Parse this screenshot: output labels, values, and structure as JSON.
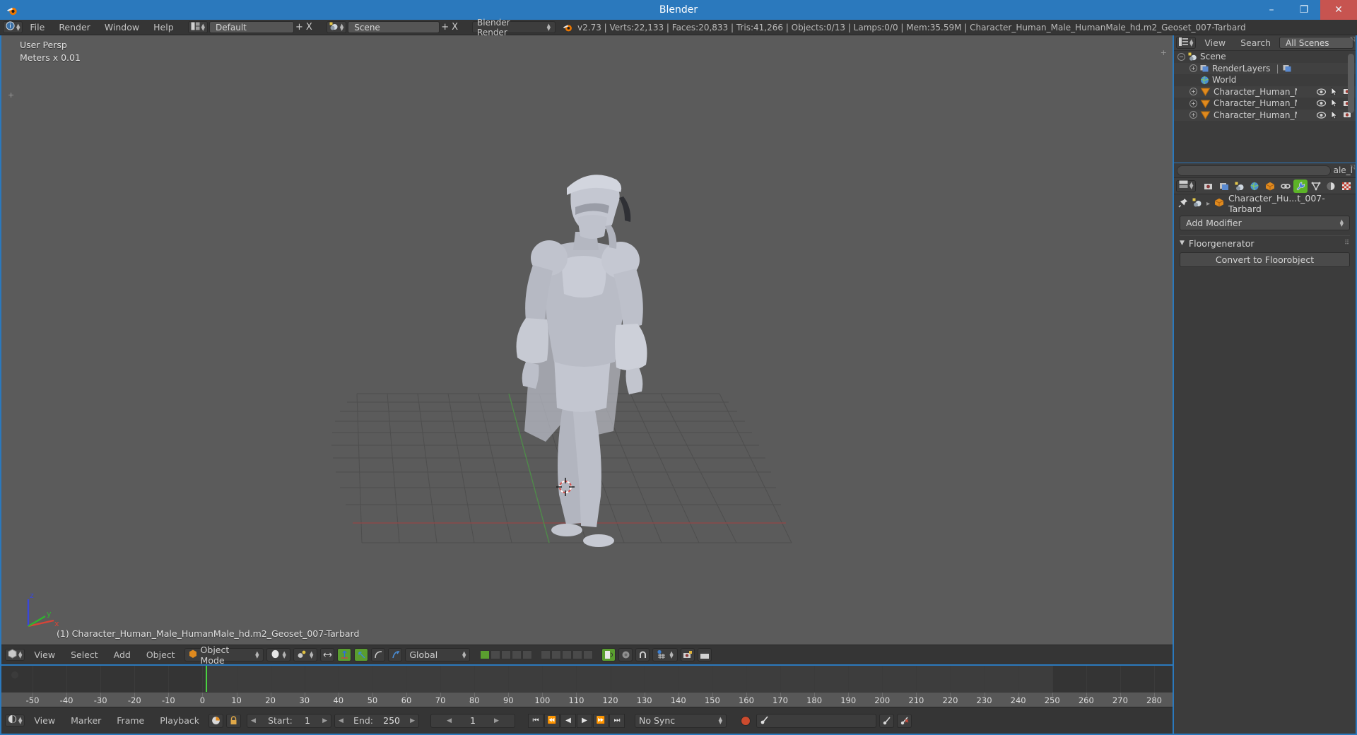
{
  "window": {
    "title": "Blender",
    "app_icon": "blender-logo-icon",
    "minimize": "–",
    "maximize": "❐",
    "close": "✕"
  },
  "topbar": {
    "editor_type_icon": "info-editor-icon",
    "menus": [
      "File",
      "Render",
      "Window",
      "Help"
    ],
    "screen_layout_icon": "screen-layout-icon",
    "screen_layout": "Default",
    "screen_add": "+",
    "screen_delete": "X",
    "scene_icon": "scene-icon",
    "scene": "Scene",
    "scene_add": "+",
    "scene_delete": "X",
    "render_engine": "Blender Render",
    "blender_icon": "blender-logo-icon",
    "status": "v2.73 | Verts:22,133 | Faces:20,833 | Tris:41,266 | Objects:0/13 | Lamps:0/0 | Mem:35.59M | Character_Human_Male_HumanMale_hd.m2_Geoset_007-Tarbard"
  },
  "viewport": {
    "perspective": "User Persp",
    "units": "Meters x 0.01",
    "active_object": "(1) Character_Human_Male_HumanMale_hd.m2_Geoset_007-Tarbard",
    "gizmo_axes": [
      "z",
      "y",
      "x"
    ],
    "background_color": "#5b5b5b",
    "header": {
      "editor_type_icon": "3d-view-icon",
      "menus": [
        "View",
        "Select",
        "Add",
        "Object"
      ],
      "mode_icon": "object-mode-icon",
      "mode": "Object Mode",
      "viewport_shading_icon": "shading-solid-icon",
      "pivot_icon": "pivot-median-icon",
      "manipulator_icon": "manipulator-icon",
      "transform_translate_icon": "translate-manipulator-icon",
      "transform_rotate_icon": "rotate-manipulator-icon",
      "transform_scale_icon": "scale-manipulator-icon",
      "orientation": "Global",
      "layers_label": "scene-layers",
      "active_layer_index": 0,
      "snap_icon": "snap-magnet-icon",
      "proportional_icon": "proportional-edit-icon",
      "render_icon": "render-preview-icon",
      "camera_icon": "add-camera-icon",
      "clip_icon": "movie-clip-icon",
      "lock_icon": "lock-icon"
    }
  },
  "timeline": {
    "ruler_ticks": [
      -50,
      -40,
      -30,
      -20,
      -10,
      0,
      10,
      20,
      30,
      40,
      50,
      60,
      70,
      80,
      90,
      100,
      110,
      120,
      130,
      140,
      150,
      160,
      170,
      180,
      190,
      200,
      210,
      220,
      230,
      240,
      250,
      260,
      270,
      280
    ],
    "range_start": 1,
    "range_end": 250,
    "playhead_frame": 1,
    "footer": {
      "editor_type_icon": "timeline-editor-icon",
      "menus": [
        "View",
        "Marker",
        "Frame",
        "Playback"
      ],
      "auto_key_icon": "record-auto-key-icon",
      "lock_icon": "lock-icon",
      "start_label": "Start:",
      "start_value": "1",
      "end_label": "End:",
      "end_value": "250",
      "current_frame": "1",
      "jump_start": "⏮",
      "prev_keyframe": "⏪",
      "play_reverse": "◀",
      "play": "▶",
      "next_keyframe": "⏩",
      "jump_end": "⏭",
      "sync_mode": "No Sync",
      "record_icon": "record-icon",
      "keying_set_icon": "keying-set-icon",
      "keying_set_value": "",
      "add_keyframe_icon": "add-keyframe-icon",
      "remove_keyframe_icon": "remove-keyframe-icon"
    }
  },
  "outliner": {
    "editor_type_icon": "outliner-editor-icon",
    "menus": [
      "View",
      "Search"
    ],
    "display_mode": "All Scenes",
    "rows": [
      {
        "label": "Scene",
        "icon": "scene-icon",
        "indent": 0,
        "expander": "collapse",
        "has_restrict": false
      },
      {
        "label": "RenderLayers",
        "icon": "renderlayers-icon",
        "indent": 1,
        "expander": "expand",
        "has_restrict": false
      },
      {
        "label": "World",
        "icon": "world-icon",
        "indent": 1,
        "expander": "none",
        "has_restrict": false
      },
      {
        "label": "Character_Human_Male",
        "icon": "mesh-object-icon",
        "indent": 1,
        "expander": "expand",
        "has_restrict": true
      },
      {
        "label": "Character_Human_Male",
        "icon": "mesh-object-icon",
        "indent": 1,
        "expander": "expand",
        "has_restrict": true
      },
      {
        "label": "Character_Human_Male",
        "icon": "mesh-object-icon",
        "indent": 1,
        "expander": "expand",
        "has_restrict": true
      }
    ],
    "restrict_icons": [
      "eye-icon",
      "cursor-select-icon",
      "camera-render-icon"
    ]
  },
  "properties": {
    "search_placeholder": "",
    "filter_tail_text": "ale_l",
    "editor_type_icon": "properties-editor-icon",
    "tabs": [
      {
        "name": "render-tab",
        "icon": "camera-back-icon",
        "active": false
      },
      {
        "name": "render-layers-tab",
        "icon": "images-icon",
        "active": false
      },
      {
        "name": "scene-tab",
        "icon": "scene-icon",
        "active": false
      },
      {
        "name": "world-tab",
        "icon": "world-globe-icon",
        "active": false
      },
      {
        "name": "object-tab",
        "icon": "orange-cube-icon",
        "active": false
      },
      {
        "name": "constraints-tab",
        "icon": "chain-link-icon",
        "active": false
      },
      {
        "name": "modifiers-tab",
        "icon": "wrench-icon",
        "active": true
      },
      {
        "name": "data-tab",
        "icon": "mesh-data-icon",
        "active": false
      },
      {
        "name": "material-tab",
        "icon": "material-sphere-icon",
        "active": false
      },
      {
        "name": "texture-tab",
        "icon": "checker-texture-icon",
        "active": false
      }
    ],
    "pin_icon": "pin-icon",
    "breadcrumb_scene_icon": "scene-icon",
    "breadcrumb_arrow": "▸",
    "breadcrumb_object_icon": "orange-cube-icon",
    "breadcrumb_object": "Character_Hu...t_007-Tarbard",
    "add_modifier_label": "Add Modifier",
    "panel": {
      "collapse_icon": "triangle-down-icon",
      "title": "Floorgenerator",
      "grip_icon": "grip-dots-icon",
      "button_label": "Convert to Floorobject"
    }
  }
}
